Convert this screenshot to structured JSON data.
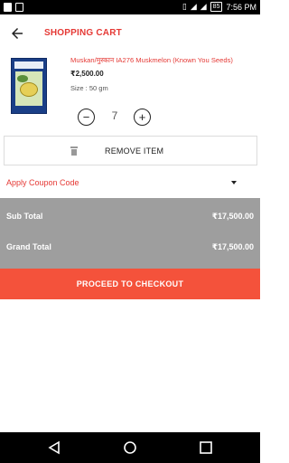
{
  "status_bar": {
    "battery": "85",
    "time": "7:56 PM"
  },
  "header": {
    "title": "SHOPPING CART"
  },
  "item": {
    "name": "Muskan/मुस्कान IA276 Muskmelon (Known You Seeds)",
    "price": "₹2,500.00",
    "size": "Size : 50 gm",
    "quantity": "7",
    "decrease_label": "−",
    "increase_label": "+"
  },
  "remove": {
    "label": "REMOVE ITEM"
  },
  "coupon": {
    "label": "Apply Coupon Code"
  },
  "totals": {
    "sub_label": "Sub Total",
    "sub_value": "₹17,500.00",
    "grand_label": "Grand Total",
    "grand_value": "₹17,500.00"
  },
  "checkout": {
    "label": "PROCEED TO CHECKOUT"
  },
  "colors": {
    "accent": "#e53935",
    "checkout_bg": "#f4523b",
    "totals_bg": "#9e9e9e"
  }
}
